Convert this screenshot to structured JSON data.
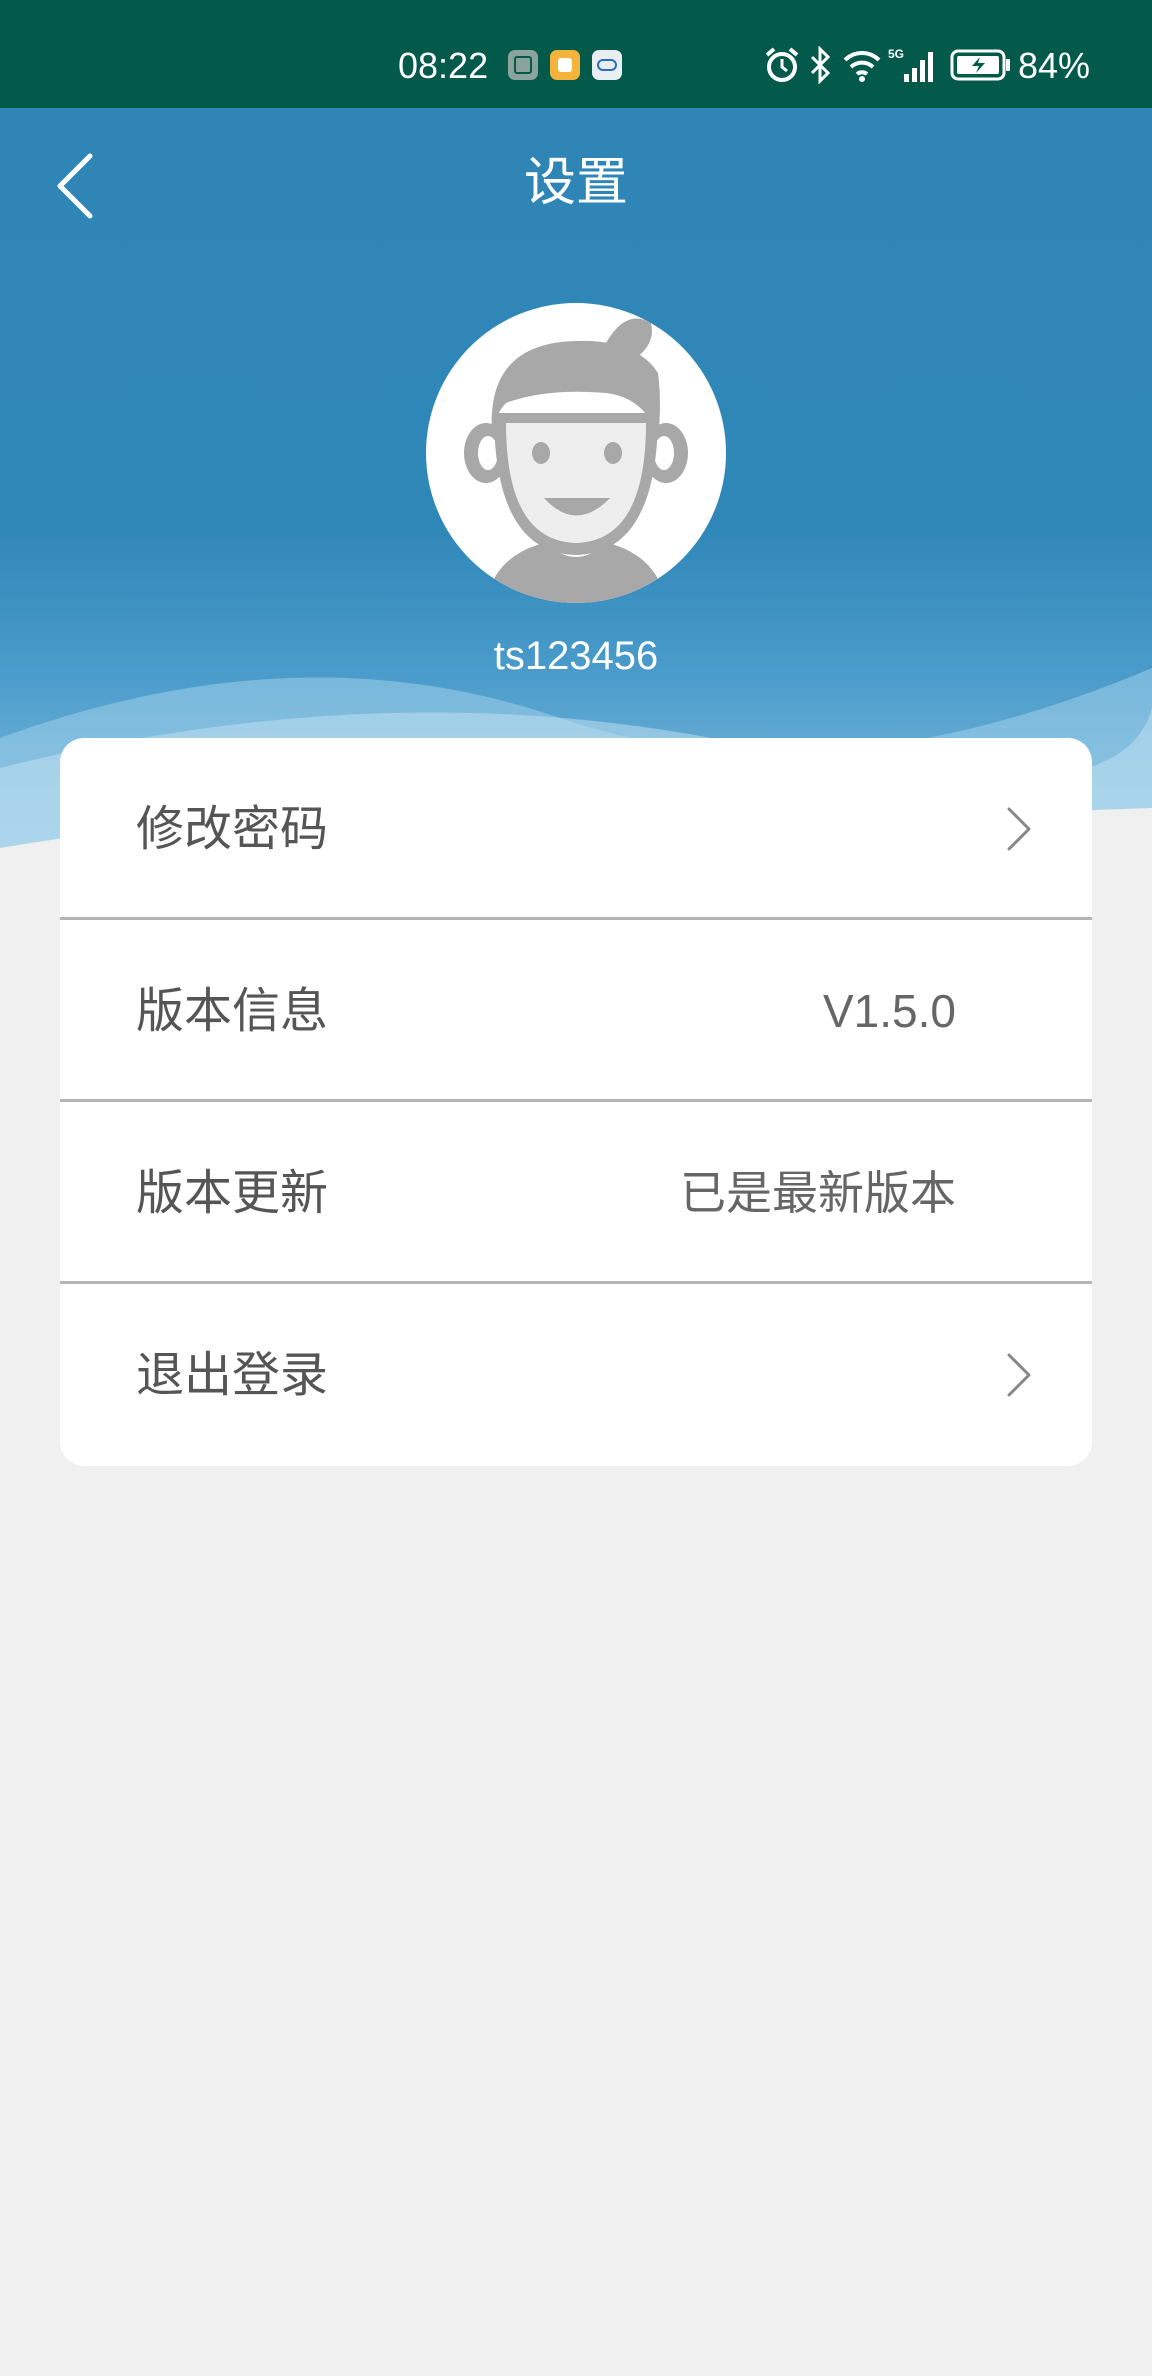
{
  "status_bar": {
    "time": "08:22",
    "battery_percent": "84%",
    "icons": [
      "hmos-app-icon",
      "shopping-bag-app-icon",
      "iflytek-app-icon",
      "alarm-icon",
      "bluetooth-icon",
      "wifi-icon",
      "5g-signal-icon",
      "battery-charging-icon"
    ]
  },
  "header": {
    "title": "设置",
    "back_icon": "chevron-left-icon"
  },
  "profile": {
    "avatar_icon": "cartoon-man-avatar",
    "username": "ts123456"
  },
  "settings": {
    "items": [
      {
        "label": "修改密码",
        "value": "",
        "icon": "chevron-right-icon"
      },
      {
        "label": "版本信息",
        "value": "V1.5.0"
      },
      {
        "label": "版本更新",
        "value": "已是最新版本"
      },
      {
        "label": "退出登录",
        "value": "",
        "icon": "chevron-right-icon"
      }
    ]
  },
  "colors": {
    "status_bar": "#035a4a",
    "header_blue": "#2f86b6",
    "page_background": "#f0f0f0",
    "card_background": "#ffffff",
    "text_gray": "#555555"
  }
}
